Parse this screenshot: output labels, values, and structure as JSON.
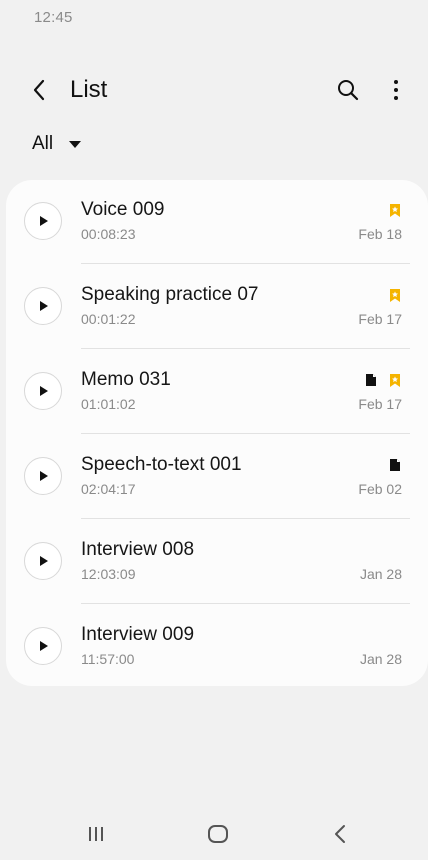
{
  "status_bar": {
    "time": "12:45"
  },
  "app_bar": {
    "title": "List",
    "back_icon": "back-chevron-icon",
    "search_icon": "search-icon",
    "more_icon": "more-vertical-icon"
  },
  "filter": {
    "selected": "All"
  },
  "colors": {
    "bookmark": "#f5b400",
    "accent_text": "#111111",
    "secondary_text": "#8a8a8a"
  },
  "recordings": [
    {
      "name": "Voice 009",
      "duration": "00:08:23",
      "date": "Feb 18",
      "has_transcript": false,
      "bookmarked": true
    },
    {
      "name": "Speaking practice 07",
      "duration": "00:01:22",
      "date": "Feb 17",
      "has_transcript": false,
      "bookmarked": true
    },
    {
      "name": "Memo 031",
      "duration": "01:01:02",
      "date": "Feb 17",
      "has_transcript": true,
      "bookmarked": true
    },
    {
      "name": "Speech-to-text 001",
      "duration": "02:04:17",
      "date": "Feb 02",
      "has_transcript": true,
      "bookmarked": false
    },
    {
      "name": "Interview 008",
      "duration": "12:03:09",
      "date": "Jan 28",
      "has_transcript": false,
      "bookmarked": false
    },
    {
      "name": "Interview 009",
      "duration": "11:57:00",
      "date": "Jan 28",
      "has_transcript": false,
      "bookmarked": false
    }
  ],
  "nav_bar": {
    "recents_icon": "recents-icon",
    "home_icon": "home-icon",
    "back_icon": "back-icon"
  }
}
